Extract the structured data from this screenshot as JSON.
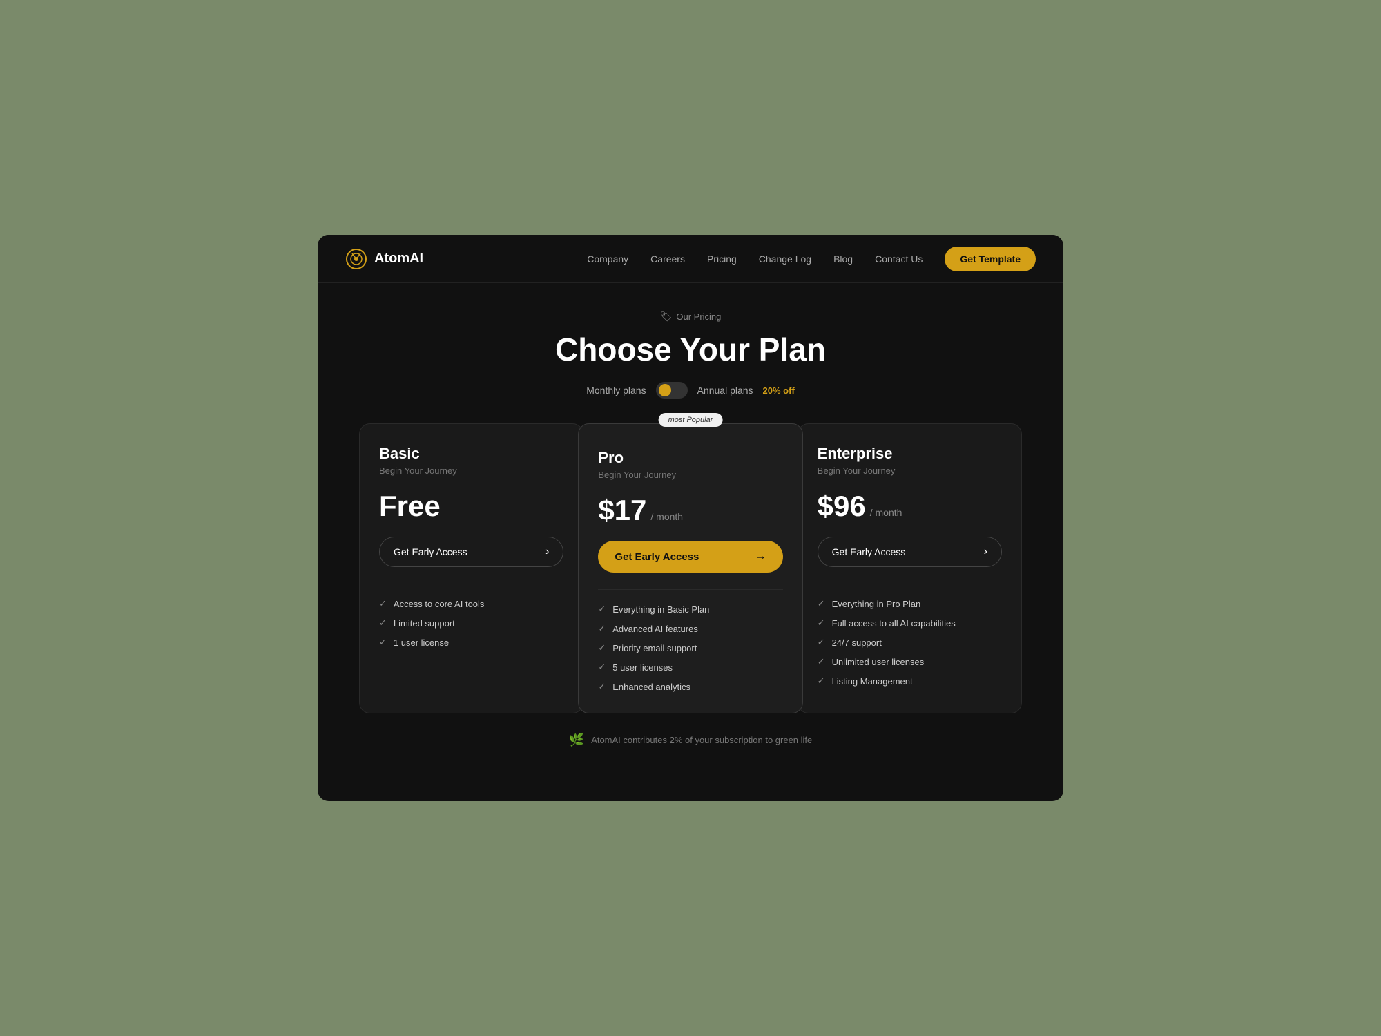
{
  "meta": {
    "title": "AtomAI Pricing"
  },
  "navbar": {
    "logo_text": "AtomAI",
    "links": [
      {
        "label": "Company",
        "id": "company"
      },
      {
        "label": "Careers",
        "id": "careers"
      },
      {
        "label": "Pricing",
        "id": "pricing"
      },
      {
        "label": "Change Log",
        "id": "changelog"
      },
      {
        "label": "Blog",
        "id": "blog"
      },
      {
        "label": "Contact Us",
        "id": "contact"
      }
    ],
    "cta_label": "Get Template"
  },
  "pricing": {
    "section_label": "Our Pricing",
    "title": "Choose Your Plan",
    "toggle": {
      "left_label": "Monthly plans",
      "right_label": "Annual plans",
      "discount": "20% off"
    },
    "plans": [
      {
        "id": "basic",
        "name": "Basic",
        "subtitle": "Begin Your Journey",
        "price": "Free",
        "price_period": "",
        "cta": "Get Early Access",
        "features": [
          "Access to core AI tools",
          "Limited support",
          "1 user license"
        ]
      },
      {
        "id": "pro",
        "name": "Pro",
        "subtitle": "Begin Your Journey",
        "price": "$17",
        "price_period": "/ month",
        "cta": "Get Early Access",
        "badge": "most Popular",
        "features": [
          "Everything in Basic Plan",
          "Advanced AI features",
          "Priority email support",
          "5 user licenses",
          "Enhanced analytics"
        ]
      },
      {
        "id": "enterprise",
        "name": "Enterprise",
        "subtitle": "Begin Your Journey",
        "price": "$96",
        "price_period": "/ month",
        "cta": "Get Early Access",
        "features": [
          "Everything in Pro Plan",
          "Full access to all AI capabilities",
          "24/7 support",
          "Unlimited user licenses",
          "Listing Management"
        ]
      }
    ],
    "footer_note": "AtomAI contributes 2% of your subscription to green life"
  }
}
